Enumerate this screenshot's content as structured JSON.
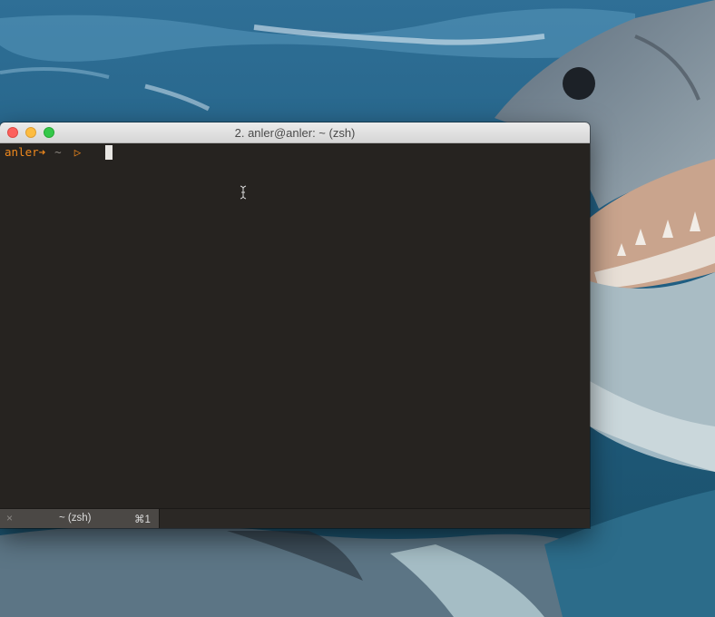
{
  "window": {
    "title": "2. anler@anler: ~ (zsh)",
    "buttons": [
      "close",
      "minimize",
      "maximize"
    ]
  },
  "terminal": {
    "prompt_user": "anler",
    "prompt_arrow": "➜",
    "prompt_dir": "~",
    "prompt_symbol": "▷",
    "input": ""
  },
  "tabs": [
    {
      "close_icon": "×",
      "title": "~ (zsh)",
      "shortcut": "⌘1"
    }
  ],
  "colors": {
    "prompt": "#f0891d",
    "terminal_bg": "#27231f",
    "titlebar": "#e3e3e3"
  },
  "icons": {
    "mouse_cursor": "ibeam-cursor-icon"
  }
}
